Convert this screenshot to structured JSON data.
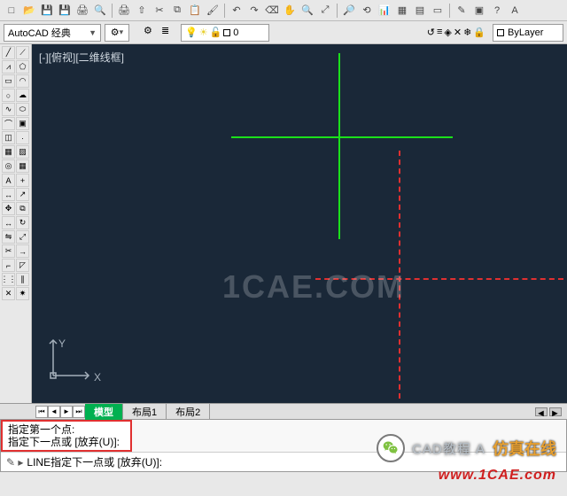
{
  "toolbar1": {
    "icons": [
      "new",
      "open",
      "save",
      "save-as",
      "print",
      "print-preview",
      "plot",
      "publish",
      "cut",
      "copy",
      "paste",
      "match",
      "undo",
      "redo",
      "eraser",
      "pan",
      "zoom-window",
      "zoom-extents",
      "zoom-realtime",
      "zoom-prev",
      "properties",
      "design-center",
      "tool-palettes",
      "sheet-set",
      "markup",
      "calculator",
      "help",
      "text-style"
    ]
  },
  "toolbar2": {
    "workspace": "AutoCAD 经典",
    "layer_state": "0",
    "linetype": "ByLayer",
    "mid_icons": [
      "gear",
      "layer-manager"
    ],
    "layer_icons": [
      "bulb",
      "sun",
      "lock",
      "color",
      "square"
    ],
    "right_icons": [
      "layer-prev",
      "layer-states",
      "layer-iso",
      "layer-off",
      "layer-freeze",
      "layer-lock"
    ]
  },
  "left_tools": [
    [
      "line",
      "construction-line"
    ],
    [
      "polyline",
      "polygon"
    ],
    [
      "rectangle",
      "arc"
    ],
    [
      "circle",
      "revision-cloud"
    ],
    [
      "spline",
      "ellipse"
    ],
    [
      "ellipse-arc",
      "insert-block"
    ],
    [
      "make-block",
      "point"
    ],
    [
      "hatch",
      "gradient"
    ],
    [
      "region",
      "table"
    ],
    [
      "mtext",
      "add-selected"
    ],
    [
      "dimension",
      "multileader"
    ],
    [
      "move",
      "copy"
    ],
    [
      "stretch",
      "rotate"
    ],
    [
      "mirror",
      "scale"
    ],
    [
      "trim",
      "extend"
    ],
    [
      "fillet",
      "chamfer"
    ],
    [
      "array",
      "offset"
    ],
    [
      "erase",
      "explode"
    ]
  ],
  "viewport": {
    "label": "[-][俯视][二维线框]"
  },
  "watermark": "1CAE.COM",
  "ucs": {
    "x": "X",
    "y": "Y"
  },
  "tabs": {
    "nav": [
      "first",
      "prev",
      "next",
      "last"
    ],
    "items": [
      {
        "label": "模型",
        "active": true
      },
      {
        "label": "布局1",
        "active": false
      },
      {
        "label": "布局2",
        "active": false
      }
    ]
  },
  "command": {
    "history": [
      "指定第一个点:",
      "指定下一点或 [放弃(U)]:"
    ],
    "prompt_kw": "LINE",
    "prompt_text": " 指定下一点或 [放弃(U)]:"
  },
  "overlay": {
    "wechat_text": "CAD教程 A",
    "fangzhen": "仿真在线",
    "url": "www.1CAE.com"
  }
}
